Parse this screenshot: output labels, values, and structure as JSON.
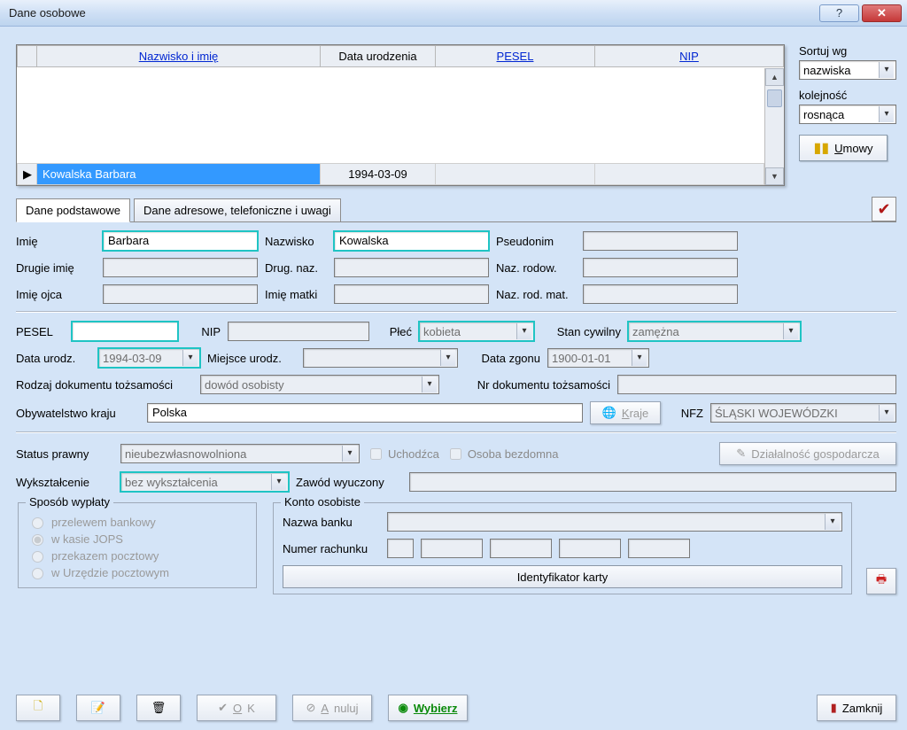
{
  "window": {
    "title": "Dane osobowe"
  },
  "columns": {
    "col0": "Nazwisko i imię",
    "col1": "Data urodzenia",
    "col2": "PESEL",
    "col3": "NIP"
  },
  "rows": [
    {
      "name": "Kowalska Barbara",
      "dob": "1994-03-09",
      "pesel": "",
      "nip": ""
    }
  ],
  "sort": {
    "label_sortwg": "Sortuj wg",
    "sortwg_value": "nazwiska",
    "label_order": "kolejność",
    "order_value": "rosnąca",
    "umowy_btn": "Umowy"
  },
  "tabs": {
    "basic": "Dane podstawowe",
    "address": "Dane adresowe, telefoniczne i uwagi"
  },
  "form": {
    "labels": {
      "imie": "Imię",
      "nazwisko": "Nazwisko",
      "pseudonim": "Pseudonim",
      "drugie_imie": "Drugie imię",
      "drug_naz": "Drug. naz.",
      "naz_rodow": "Naz. rodow.",
      "imie_ojca": "Imię ojca",
      "imie_matki": "Imię matki",
      "naz_rod_mat": "Naz. rod. mat.",
      "pesel": "PESEL",
      "nip": "NIP",
      "plec": "Płeć",
      "stan_cywilny": "Stan cywilny",
      "data_urodz": "Data urodz.",
      "miejsce_urodz": "Miejsce urodz.",
      "data_zgonu": "Data zgonu",
      "rodzaj_dok": "Rodzaj dokumentu tożsamości",
      "nr_dok": "Nr dokumentu tożsamości",
      "obywatelstwo": "Obywatelstwo kraju",
      "kraje_btn": "Kraje",
      "nfz": "NFZ",
      "status_prawny": "Status prawny",
      "uchodzca": "Uchodźca",
      "bezdomna": "Osoba bezdomna",
      "dzialalnosc": "Działalność gospodarcza",
      "wyksztalcenie": "Wykształcenie",
      "zawod": "Zawód wyuczony",
      "sposob_wyplaty": "Sposób wypłaty",
      "przelew": "przelewem bankowy",
      "kasa": "w kasie JOPS",
      "przekaz": "przekazem pocztowy",
      "urzad": "w Urzędzie pocztowym",
      "konto": "Konto osobiste",
      "bank": "Nazwa banku",
      "rachunek": "Numer rachunku",
      "ident": "Identyfikator karty"
    },
    "values": {
      "imie": "Barbara",
      "nazwisko": "Kowalska",
      "pseudonim": "",
      "drugie_imie": "",
      "drug_naz": "",
      "naz_rodow": "",
      "imie_ojca": "",
      "imie_matki": "",
      "naz_rod_mat": "",
      "pesel": "",
      "nip": "",
      "plec": "kobieta",
      "stan_cywilny": "zamężna",
      "data_urodz": "1994-03-09",
      "miejsce_urodz": "",
      "data_zgonu": "1900-01-01",
      "rodzaj_dok": "dowód osobisty",
      "nr_dok": "",
      "obywatelstwo": "Polska",
      "nfz": "ŚLĄSKI WOJEWÓDZKI",
      "status_prawny": "nieubezwłasnowolniona",
      "wyksztalcenie": "bez wykształcenia",
      "zawod": "",
      "bank": "",
      "rachunek": ""
    }
  },
  "buttons": {
    "ok": "OK",
    "anuluj": "Anuluj",
    "wybierz": "Wybierz",
    "zamknij": "Zamknij"
  }
}
